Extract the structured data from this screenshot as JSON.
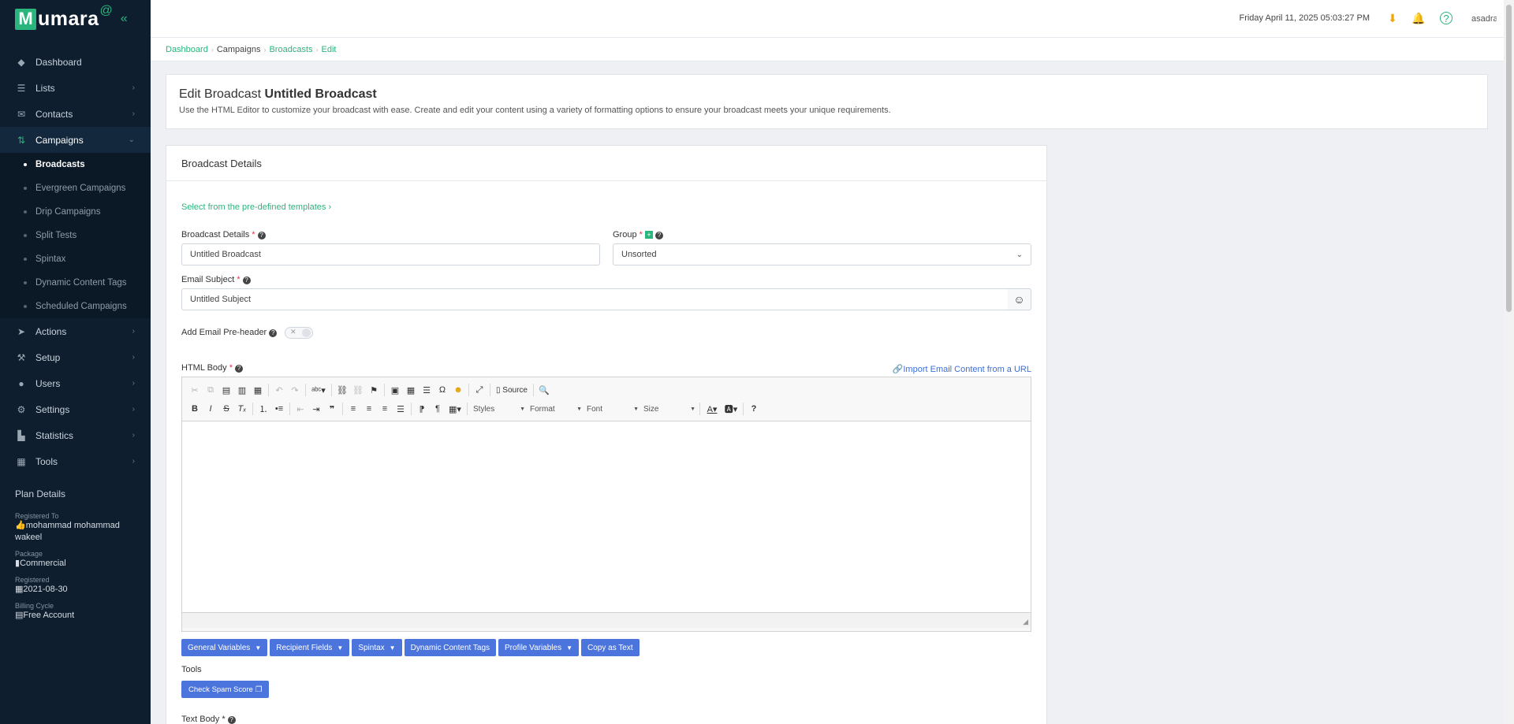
{
  "brand": {
    "logo_letter": "M",
    "logo_text": "umara",
    "logo_at": "@"
  },
  "sidebar": {
    "items": [
      {
        "label": "Dashboard"
      },
      {
        "label": "Lists"
      },
      {
        "label": "Contacts"
      },
      {
        "label": "Campaigns"
      },
      {
        "label": "Actions"
      },
      {
        "label": "Setup"
      },
      {
        "label": "Users"
      },
      {
        "label": "Settings"
      },
      {
        "label": "Statistics"
      },
      {
        "label": "Tools"
      }
    ],
    "campaign_sub": [
      {
        "label": "Broadcasts"
      },
      {
        "label": "Evergreen Campaigns"
      },
      {
        "label": "Drip Campaigns"
      },
      {
        "label": "Split Tests"
      },
      {
        "label": "Spintax"
      },
      {
        "label": "Dynamic Content Tags"
      },
      {
        "label": "Scheduled Campaigns"
      }
    ],
    "plan": {
      "title": "Plan Details",
      "registered_to_label": "Registered To",
      "registered_to": "mohammad mohammad wakeel",
      "package_label": "Package",
      "package": "Commercial",
      "registered_label": "Registered",
      "registered": "2021-08-30",
      "billing_label": "Billing Cycle",
      "billing": "Free Account"
    }
  },
  "header": {
    "datetime": "Friday April 11, 2025 05:03:27 PM",
    "avatar_alt": "asadra"
  },
  "breadcrumb": {
    "b1": "Dashboard",
    "b2": "Campaigns",
    "b3": "Broadcasts",
    "b4": "Edit"
  },
  "page": {
    "title_prefix": "Edit Broadcast",
    "title_name": "Untitled Broadcast",
    "description": "Use the HTML Editor to customize your broadcast with ease. Create and edit your content using a variety of formatting options to ensure your broadcast meets your unique requirements."
  },
  "form": {
    "card_title": "Broadcast Details",
    "templates_link": "Select from the pre-defined templates",
    "name_label": "Broadcast Details",
    "name_value": "Untitled Broadcast",
    "group_label": "Group",
    "group_value": "Unsorted",
    "subject_label": "Email Subject",
    "subject_value": "Untitled Subject",
    "preheader_label": "Add Email Pre-header",
    "html_body_label": "HTML Body",
    "import_link": "Import Email Content from a URL",
    "source_label": "Source",
    "styles_label": "Styles",
    "format_label": "Format",
    "font_label": "Font",
    "size_label": "Size",
    "buttons": {
      "general": "General Variables",
      "recipient": "Recipient Fields",
      "spintax": "Spintax",
      "dynamic": "Dynamic Content Tags",
      "profile": "Profile Variables",
      "copy": "Copy as Text"
    },
    "tools_label": "Tools",
    "spam_button": "Check Spam Score",
    "text_body_label": "Text Body"
  },
  "colors": {
    "accent": "#2ab57d",
    "sidebar": "#0e1e2e",
    "button": "#4c74dd"
  }
}
